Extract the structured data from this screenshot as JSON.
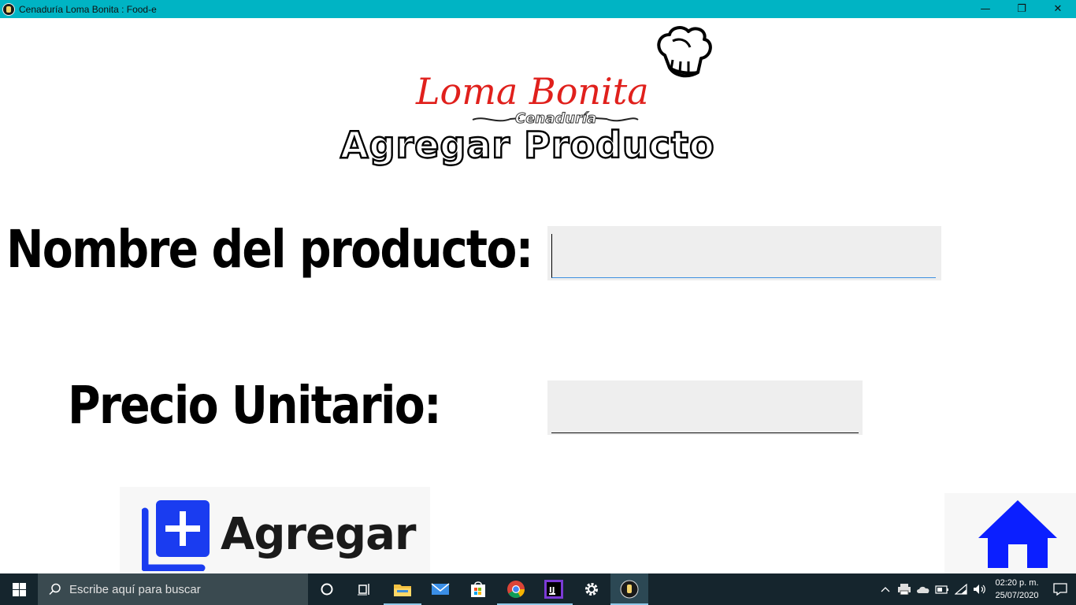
{
  "window": {
    "title": "Cenaduría Loma Bonita : Food-e",
    "controls": {
      "minimize": "—",
      "maximize": "❐",
      "close": "✕"
    }
  },
  "logo": {
    "name": "Loma Bonita",
    "tagline": "Cenaduría"
  },
  "page": {
    "heading": "Agregar Producto"
  },
  "form": {
    "product_name": {
      "label": "Nombre del producto:",
      "value": "",
      "placeholder": ""
    },
    "unit_price": {
      "label": "Precio Unitario:",
      "value": "",
      "placeholder": ""
    }
  },
  "actions": {
    "add_label": "Agregar",
    "home_icon": "home-icon",
    "add_icon": "add-box-icon"
  },
  "colors": {
    "titlebar": "#00b4c4",
    "logo_red": "#e0201c",
    "add_icon_blue": "#1a3cf0",
    "home_blue": "#0b1fff",
    "taskbar": "#15252d"
  },
  "taskbar": {
    "search_placeholder": "Escribe aquí para buscar",
    "time": "02:20 p. m.",
    "date": "25/07/2020"
  }
}
